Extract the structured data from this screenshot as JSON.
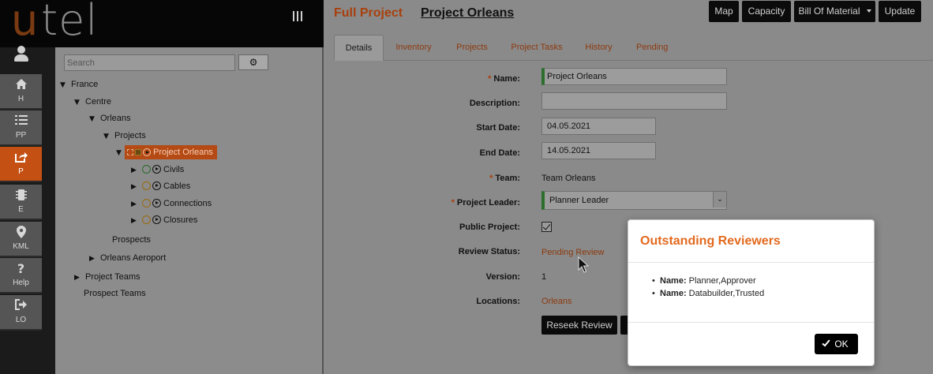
{
  "app": {
    "logo_u": "u",
    "logo_tel": "tel"
  },
  "nav": {
    "items": [
      {
        "label": "H",
        "icon": "home-icon"
      },
      {
        "label": "PP",
        "icon": "list-icon"
      },
      {
        "label": "P",
        "icon": "share-icon"
      },
      {
        "label": "E",
        "icon": "chip-icon"
      },
      {
        "label": "KML",
        "icon": "map-pin-icon"
      },
      {
        "label": "Help",
        "icon": "question-icon"
      },
      {
        "label": "LO",
        "icon": "logout-icon"
      }
    ],
    "active_color": "#c45013"
  },
  "tree": {
    "search_placeholder": "Search",
    "nodes": {
      "france": "France",
      "centre": "Centre",
      "orleans": "Orleans",
      "projects": "Projects",
      "project_orleans": "Project Orleans",
      "civils": "Civils",
      "cables": "Cables",
      "connections": "Connections",
      "closures": "Closures",
      "prospects": "Prospects",
      "orleans_aeroport": "Orleans Aeroport",
      "project_teams": "Project Teams",
      "prospect_teams": "Prospect Teams"
    }
  },
  "header": {
    "type": "Full Project",
    "name": "Project Orleans",
    "buttons": {
      "map": "Map",
      "capacity": "Capacity",
      "bom": "Bill Of Material",
      "update": "Update"
    }
  },
  "tabs": [
    "Details",
    "Inventory",
    "Projects",
    "Project Tasks",
    "History",
    "Pending"
  ],
  "form": {
    "name_label": "Name:",
    "name_value": "Project Orleans",
    "description_label": "Description:",
    "description_value": "",
    "start_label": "Start Date:",
    "start_value": "04.05.2021",
    "end_label": "End Date:",
    "end_value": "14.05.2021",
    "team_label": "Team:",
    "team_value": "Team Orleans",
    "leader_label": "Project Leader:",
    "leader_value": "Planner Leader",
    "public_label": "Public Project:",
    "public_checked": true,
    "review_label": "Review Status:",
    "review_value": "Pending Review",
    "version_label": "Version:",
    "version_value": "1",
    "locations_label": "Locations:",
    "locations_value": "Orleans",
    "reseek_button": "Reseek Review"
  },
  "modal": {
    "title": "Outstanding Reviewers",
    "reviewers": [
      {
        "key": "Name:",
        "value": "Planner,Approver"
      },
      {
        "key": "Name:",
        "value": "Databuilder,Trusted"
      }
    ],
    "ok_label": "OK",
    "title_color": "#e2691d"
  },
  "colors": {
    "accent": "#a8400c",
    "link": "#8b3a0e",
    "required_bar": "#2c6e2c"
  }
}
